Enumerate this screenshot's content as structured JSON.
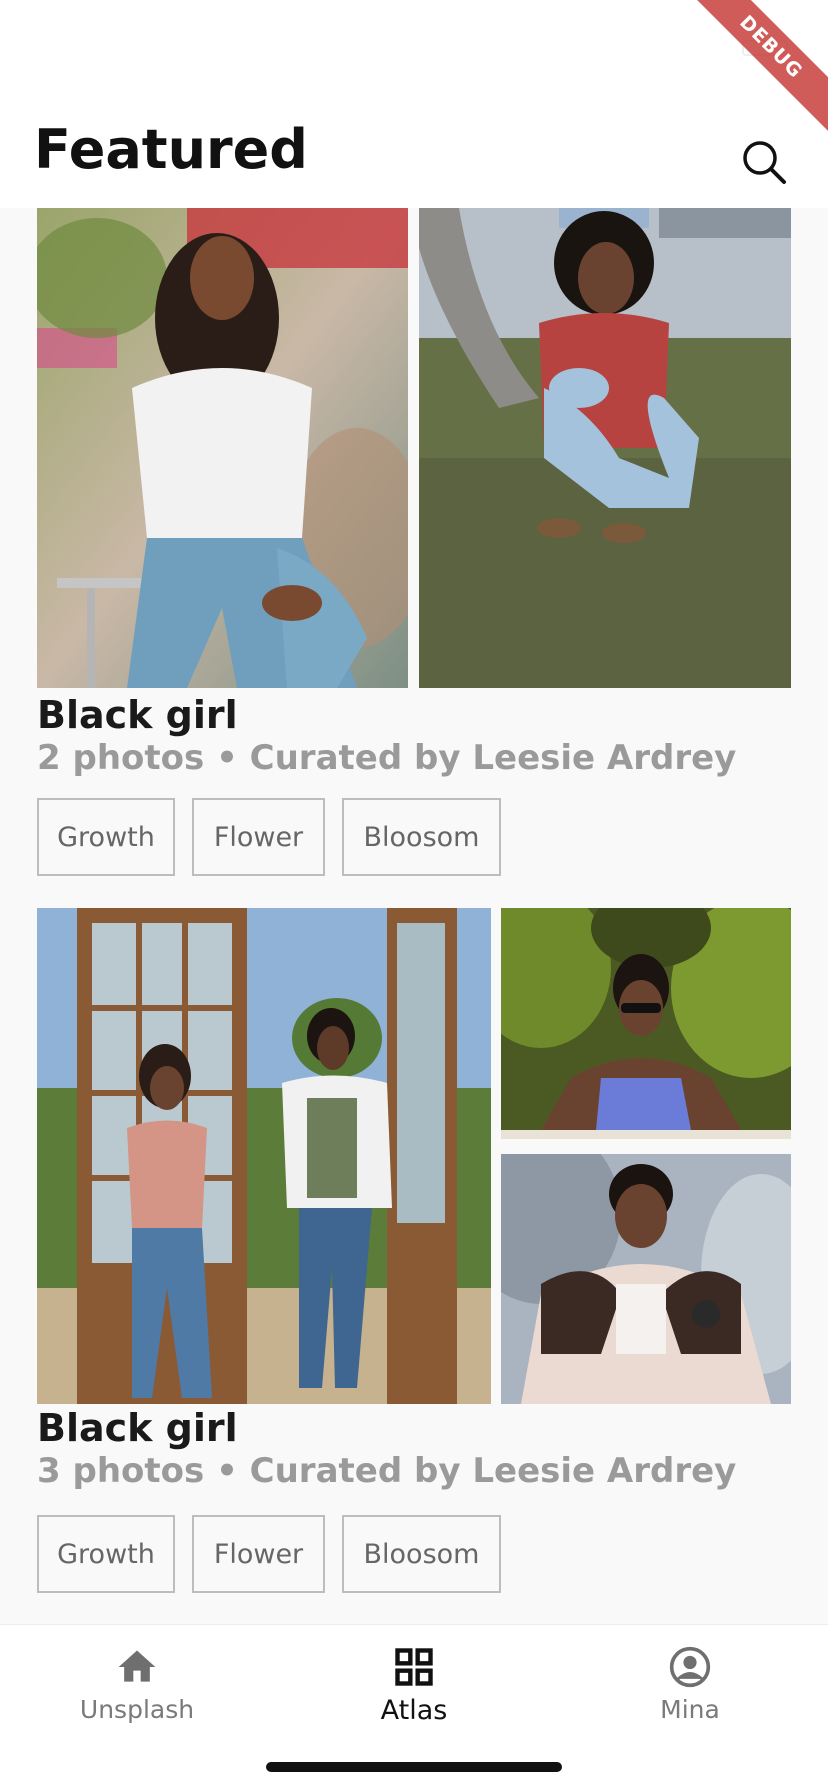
{
  "header": {
    "title": "Featured",
    "debug_label": "DEBUG",
    "search_icon": "search-icon"
  },
  "collections": [
    {
      "title": "Black girl",
      "subtitle": "2 photos • Curated by Leesie Ardrey",
      "tags": [
        "Growth",
        "Flower",
        "Bloosom"
      ]
    },
    {
      "title": "Black girl",
      "subtitle": "3 photos • Curated by Leesie Ardrey",
      "tags": [
        "Growth",
        "Flower",
        "Bloosom"
      ]
    }
  ],
  "bottom_nav": {
    "items": [
      {
        "label": "Unsplash",
        "icon": "home-icon",
        "active": false
      },
      {
        "label": "Atlas",
        "icon": "grid-icon",
        "active": true
      },
      {
        "label": "Mina",
        "icon": "account-icon",
        "active": false
      }
    ]
  },
  "colors": {
    "background": "#f9f9f9",
    "title_text": "#111111",
    "subtitle_text": "#9a9a9a",
    "tag_border": "#bdbdbd",
    "debug_banner": "#c8403d"
  }
}
